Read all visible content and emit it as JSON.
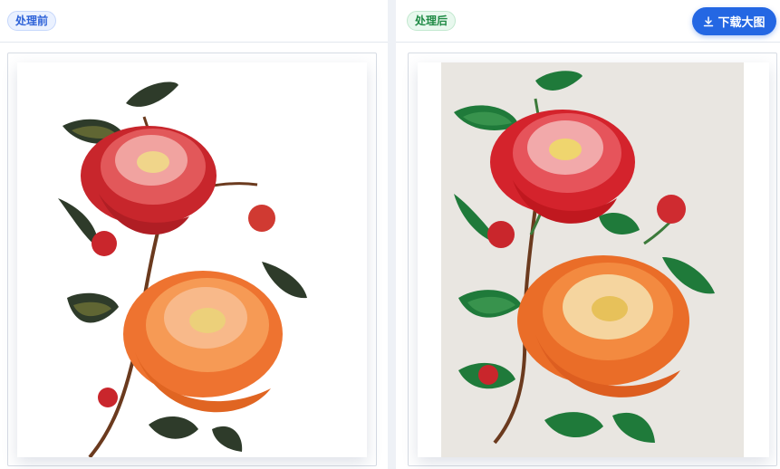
{
  "before_panel": {
    "badge_label": "处理前",
    "image_alt": "peony-illustration-original"
  },
  "after_panel": {
    "badge_label": "处理后",
    "image_alt": "peony-embroidery-processed",
    "download_label": "下载大图",
    "download_icon": "download-icon"
  },
  "colors": {
    "accent": "#2467e3",
    "before_badge": "#2d62d8",
    "after_badge": "#1f8a45"
  }
}
